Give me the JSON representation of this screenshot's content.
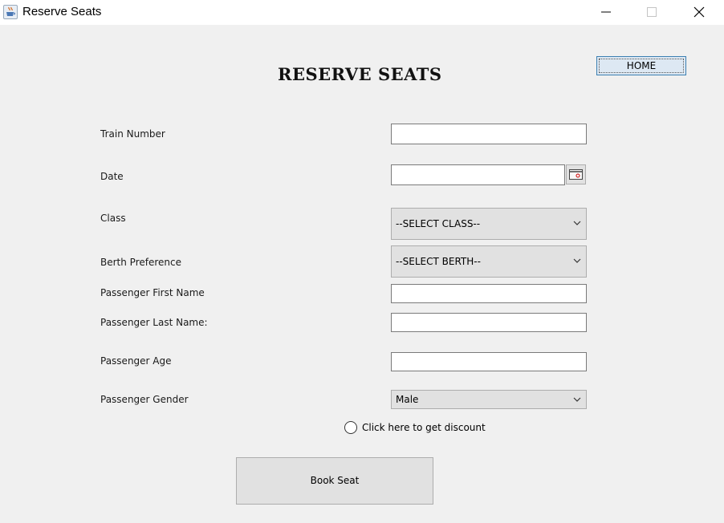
{
  "window": {
    "title": "Reserve Seats",
    "icon": "java-cup-icon"
  },
  "header": {
    "title": "RESERVE SEATS",
    "home_label": "HOME"
  },
  "form": {
    "train_number": {
      "label": "Train Number",
      "value": ""
    },
    "date": {
      "label": "Date",
      "value": "",
      "picker_icon": "calendar-icon"
    },
    "class": {
      "label": "Class",
      "selected": "--SELECT CLASS--"
    },
    "berth": {
      "label": "Berth Preference",
      "selected": "--SELECT BERTH--"
    },
    "first_name": {
      "label": "Passenger First Name",
      "value": ""
    },
    "last_name": {
      "label": "Passenger Last Name:",
      "value": ""
    },
    "age": {
      "label": "Passenger Age",
      "value": ""
    },
    "gender": {
      "label": "Passenger Gender",
      "selected": "Male"
    },
    "discount": {
      "label": "Click here to get discount",
      "checked": false
    },
    "submit_label": "Book Seat"
  }
}
